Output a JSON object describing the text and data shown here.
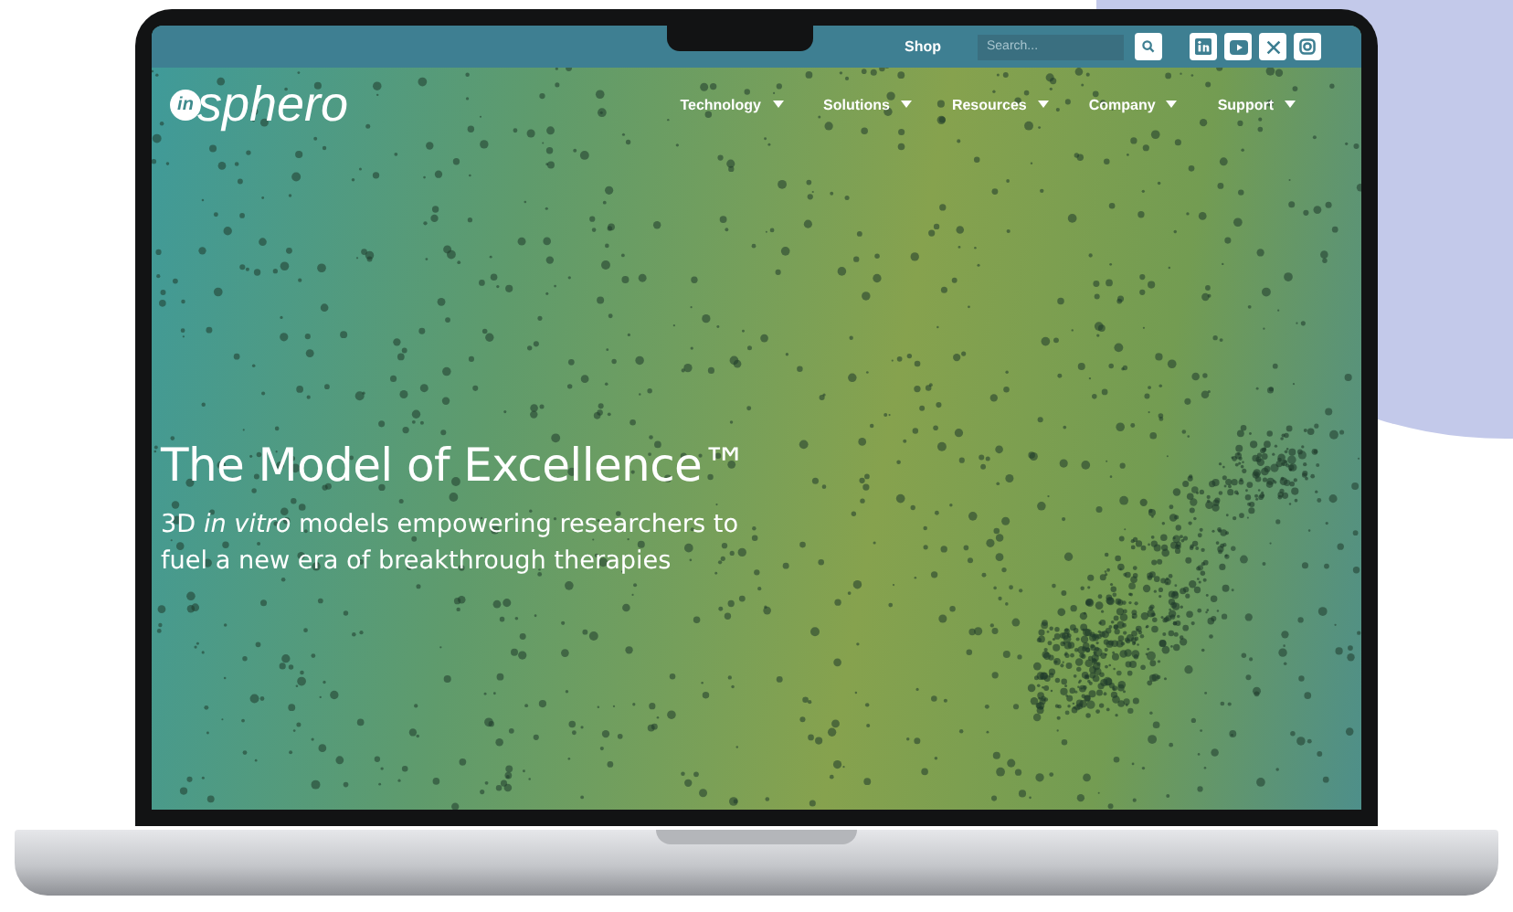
{
  "utility_bar": {
    "shop_link": "Shop",
    "search": {
      "placeholder": "Search..."
    }
  },
  "logo": {
    "badge": "in",
    "wordmark": "sphero"
  },
  "nav": [
    {
      "label": "Technology"
    },
    {
      "label": "Solutions"
    },
    {
      "label": "Resources"
    },
    {
      "label": "Company"
    },
    {
      "label": "Support"
    }
  ],
  "hero": {
    "title": "The Model of Excellence™",
    "subtitle": "3D *in vitro* models empowering researchers to fuel a new era of breakthrough therapies"
  }
}
